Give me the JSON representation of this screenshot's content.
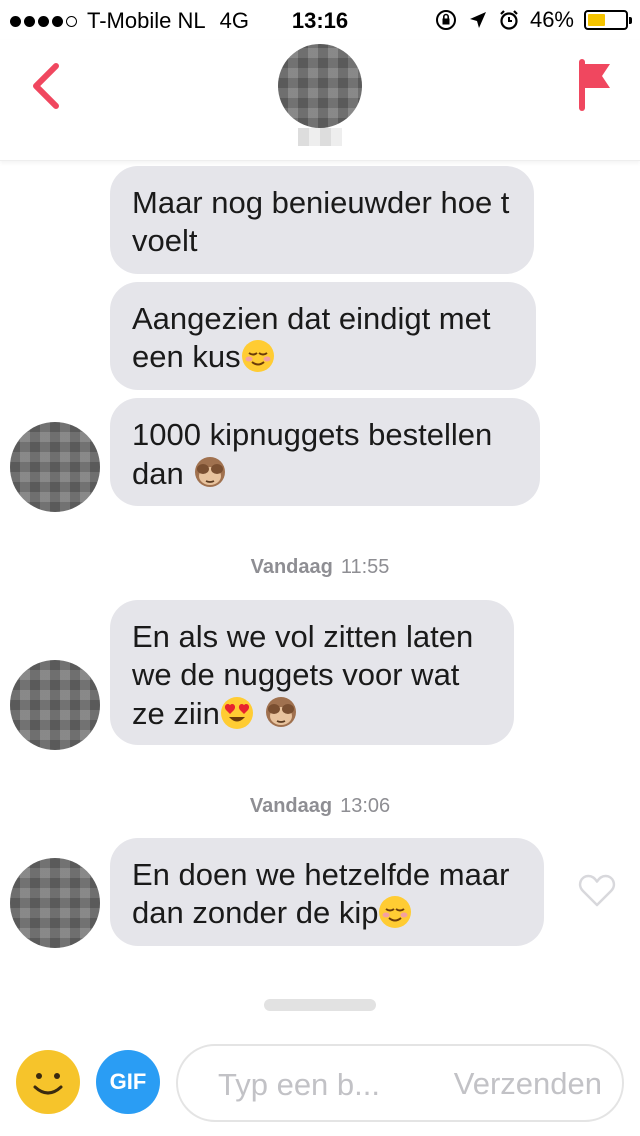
{
  "status_bar": {
    "carrier": "T-Mobile NL",
    "network": "4G",
    "time": "13:16",
    "battery": "46%",
    "battery_level": 0.46,
    "signal_bars": 4,
    "signal_max": 5,
    "battery_color": "#f5c400",
    "icons": [
      "rotation-lock-icon",
      "location-arrow-icon",
      "alarm-icon"
    ]
  },
  "nav": {
    "back_icon": "chevron-left-icon",
    "report_icon": "flag-icon",
    "accent": "#f0475f"
  },
  "messages": [
    {
      "text": "Maar nog benieuwder hoe t voelt",
      "emoji": ""
    },
    {
      "text": "Aangezien dat eindigt met een kus",
      "emoji": "relieved-face-emoji"
    },
    {
      "text": "1000 kipnuggets bestellen dan ",
      "emoji": "see-no-evil-monkey-emoji"
    },
    {
      "text": "En als we vol zitten laten we de nuggets voor wat ze ziin",
      "emoji": "heart-eyes-emoji see-no-evil-monkey-emoji"
    },
    {
      "text": "En doen we hetzelfde maar dan zonder de kip",
      "emoji": "relieved-face-emoji"
    }
  ],
  "timestamps": [
    {
      "day": "Vandaag",
      "time": "11:55"
    },
    {
      "day": "Vandaag",
      "time": "13:06"
    }
  ],
  "composer": {
    "placeholder": "Typ een b...",
    "send_label": "Verzenden",
    "gif_label": "GIF",
    "emoji_button_color": "#f6c42b",
    "gif_button_color": "#2a9df4"
  },
  "bubble_color": "#e5e5ea"
}
